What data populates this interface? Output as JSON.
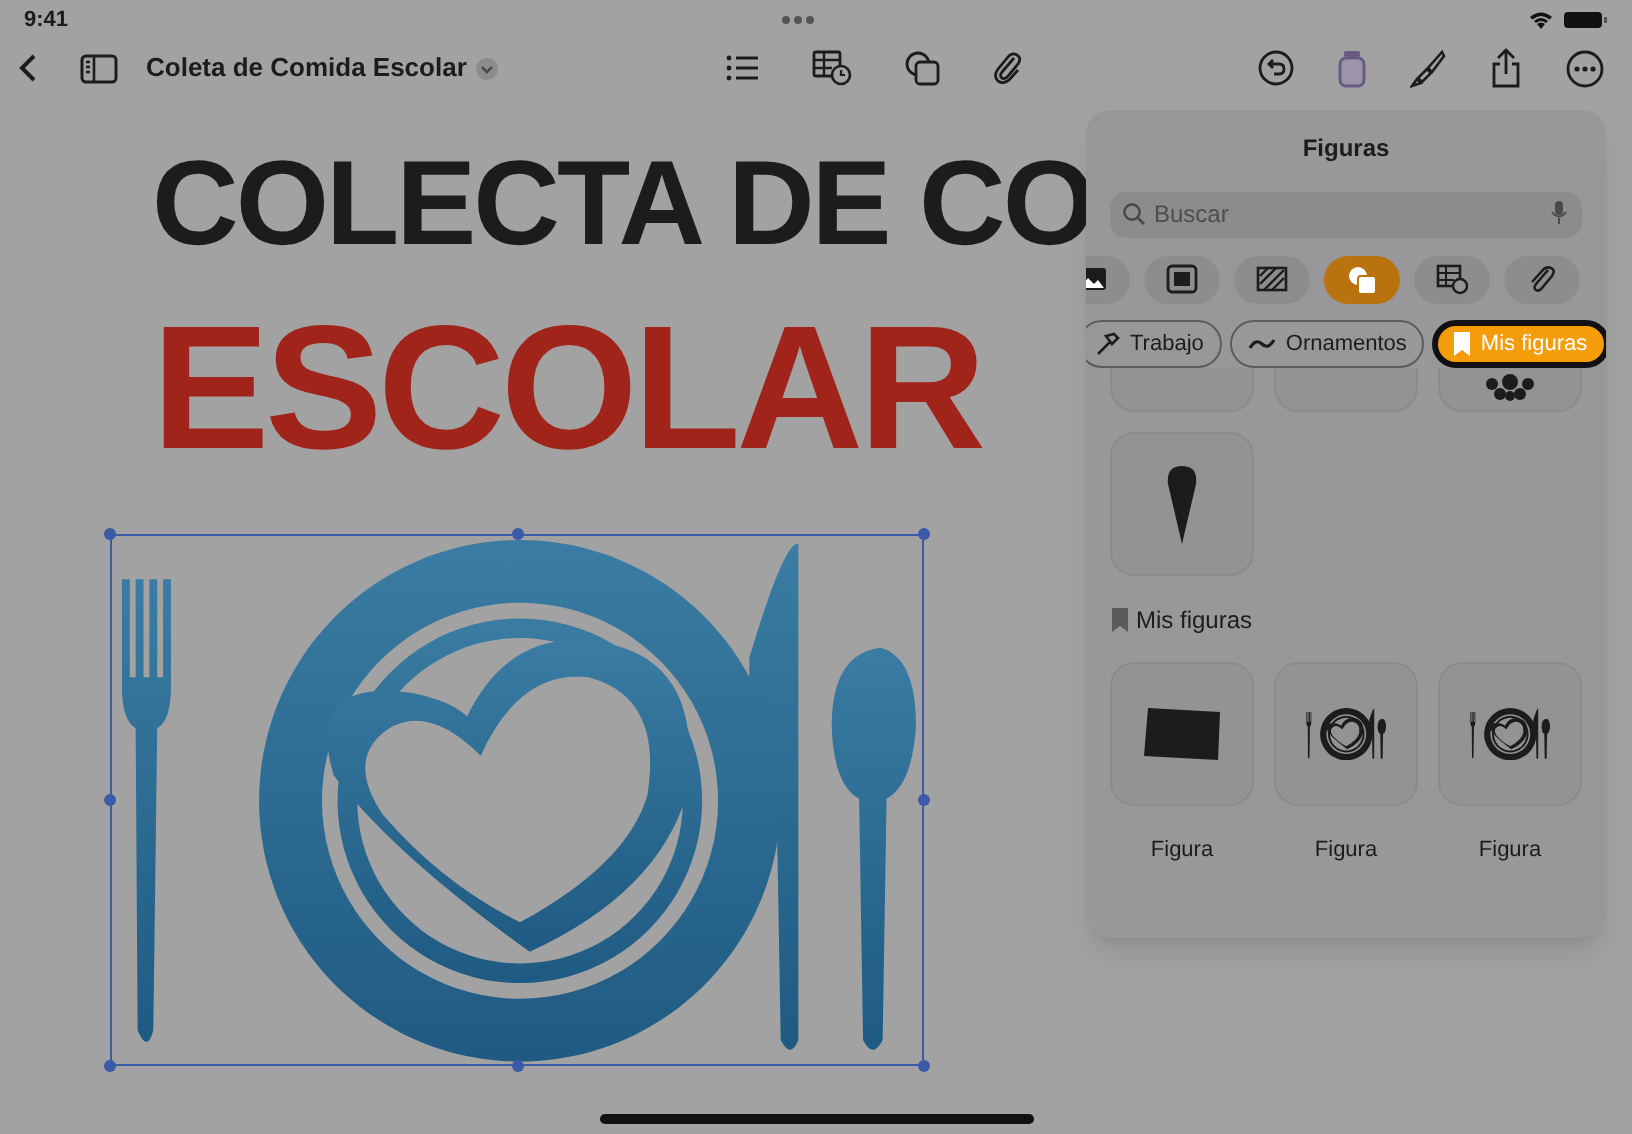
{
  "status_bar": {
    "time": "9:41"
  },
  "toolbar": {
    "document_title": "Coleta de Comida Escolar"
  },
  "document": {
    "heading_lines": [
      {
        "text": "COLECTA DE CO",
        "color": "#1c1c1c"
      },
      {
        "text": "ESCOLAR",
        "color": "#a1241b"
      }
    ],
    "selected_shape": true
  },
  "shapes_panel": {
    "title": "Figuras",
    "search": {
      "placeholder": "Buscar"
    },
    "categories": [
      {
        "kind": "photo",
        "selected": false
      },
      {
        "kind": "gallery",
        "selected": false
      },
      {
        "kind": "texture",
        "selected": false
      },
      {
        "kind": "shapes",
        "selected": true
      },
      {
        "kind": "table",
        "selected": false
      },
      {
        "kind": "clip",
        "selected": false
      }
    ],
    "chips": [
      {
        "label": "Trabajo",
        "selected": false
      },
      {
        "label": "Ornamentos",
        "selected": false
      },
      {
        "label": "Mis figuras",
        "selected": true
      }
    ],
    "section_title": "Mis figuras",
    "my_shapes": [
      {
        "label": "Figura",
        "kind": "rectangle"
      },
      {
        "label": "Figura",
        "kind": "place-setting"
      },
      {
        "label": "Figura",
        "kind": "place-setting"
      }
    ]
  }
}
